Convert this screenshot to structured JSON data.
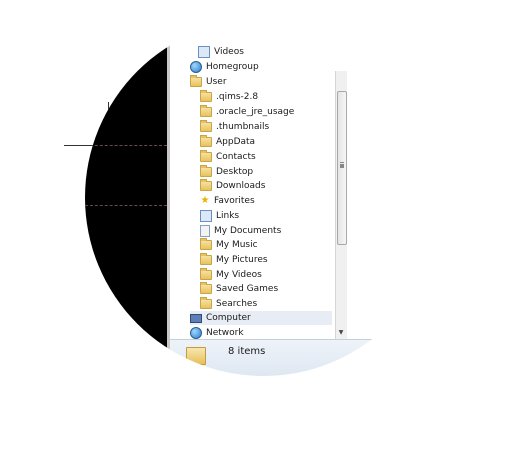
{
  "nav_tree": {
    "items": [
      {
        "label": "Videos",
        "icon": "video-library-icon"
      },
      {
        "label": "Homegroup",
        "icon": "homegroup-icon"
      },
      {
        "label": "User",
        "icon": "user-folder-icon"
      },
      {
        "label": ".qims-2.8",
        "icon": "folder-icon"
      },
      {
        "label": ".oracle_jre_usage",
        "icon": "folder-icon"
      },
      {
        "label": ".thumbnails",
        "icon": "folder-icon"
      },
      {
        "label": "AppData",
        "icon": "folder-icon"
      },
      {
        "label": "Contacts",
        "icon": "folder-icon"
      },
      {
        "label": "Desktop",
        "icon": "folder-icon"
      },
      {
        "label": "Downloads",
        "icon": "folder-icon"
      },
      {
        "label": "Favorites",
        "icon": "star-icon"
      },
      {
        "label": "Links",
        "icon": "link-icon"
      },
      {
        "label": "My Documents",
        "icon": "doc-icon"
      },
      {
        "label": "My Music",
        "icon": "folder-icon"
      },
      {
        "label": "My Pictures",
        "icon": "folder-icon"
      },
      {
        "label": "My Videos",
        "icon": "folder-icon"
      },
      {
        "label": "Saved Games",
        "icon": "folder-icon"
      },
      {
        "label": "Searches",
        "icon": "folder-icon"
      },
      {
        "label": "Computer",
        "icon": "computer-icon"
      },
      {
        "label": "Network",
        "icon": "network-icon"
      }
    ]
  },
  "status_bar": {
    "item_count": "8 items"
  }
}
